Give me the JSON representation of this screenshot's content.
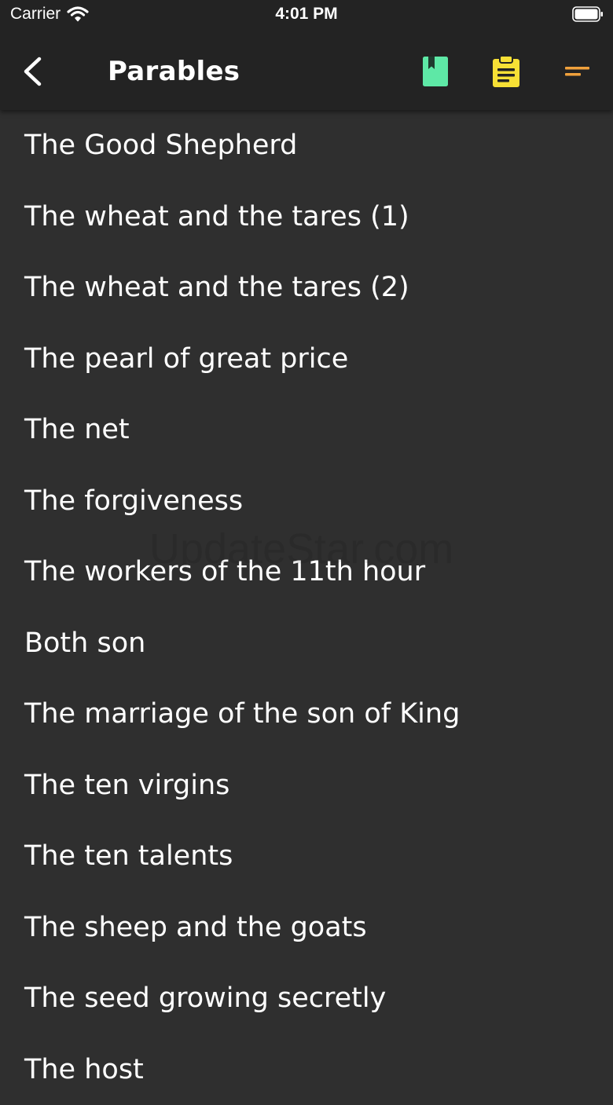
{
  "status_bar": {
    "carrier": "Carrier",
    "time": "4:01 PM"
  },
  "nav": {
    "title": "Parables",
    "icons": {
      "back": "chevron-left-icon",
      "book": "book-bookmark-icon",
      "clipboard": "clipboard-icon",
      "sort": "sort-lines-icon"
    },
    "colors": {
      "book": "#5ee8a6",
      "clipboard": "#f7e035",
      "sort": "#f0a13c"
    }
  },
  "parables": [
    "The Good Shepherd",
    "The wheat and the tares (1)",
    "The wheat and the tares (2)",
    "The pearl of great price",
    "The net",
    "The forgiveness",
    "The workers of the 11th hour",
    "Both son",
    "The marriage of the son of King",
    "The ten virgins",
    "The ten talents",
    "The sheep and the goats",
    "The seed growing secretly",
    "The host"
  ],
  "watermark": "UpdateStar.com"
}
